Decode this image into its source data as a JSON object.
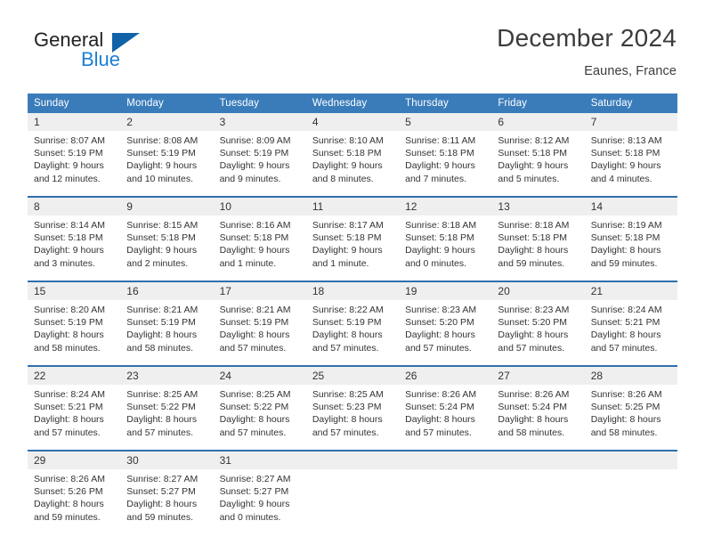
{
  "brand": {
    "name_part1": "General",
    "name_part2": "Blue",
    "triangle_color": "#1163a8",
    "blue_text_color": "#1b7fd4"
  },
  "header": {
    "title": "December 2024",
    "location": "Eaunes, France"
  },
  "theme": {
    "header_blue": "#3a7cba",
    "row_rule_blue": "#2f6fae",
    "daynum_band": "#efefef",
    "text": "#333333"
  },
  "calendar": {
    "weekday_headers": [
      "Sunday",
      "Monday",
      "Tuesday",
      "Wednesday",
      "Thursday",
      "Friday",
      "Saturday"
    ],
    "weeks": [
      {
        "days": [
          {
            "date": "1",
            "sunrise": "Sunrise: 8:07 AM",
            "sunset": "Sunset: 5:19 PM",
            "daylight_line1": "Daylight: 9 hours",
            "daylight_line2": "and 12 minutes."
          },
          {
            "date": "2",
            "sunrise": "Sunrise: 8:08 AM",
            "sunset": "Sunset: 5:19 PM",
            "daylight_line1": "Daylight: 9 hours",
            "daylight_line2": "and 10 minutes."
          },
          {
            "date": "3",
            "sunrise": "Sunrise: 8:09 AM",
            "sunset": "Sunset: 5:19 PM",
            "daylight_line1": "Daylight: 9 hours",
            "daylight_line2": "and 9 minutes."
          },
          {
            "date": "4",
            "sunrise": "Sunrise: 8:10 AM",
            "sunset": "Sunset: 5:18 PM",
            "daylight_line1": "Daylight: 9 hours",
            "daylight_line2": "and 8 minutes."
          },
          {
            "date": "5",
            "sunrise": "Sunrise: 8:11 AM",
            "sunset": "Sunset: 5:18 PM",
            "daylight_line1": "Daylight: 9 hours",
            "daylight_line2": "and 7 minutes."
          },
          {
            "date": "6",
            "sunrise": "Sunrise: 8:12 AM",
            "sunset": "Sunset: 5:18 PM",
            "daylight_line1": "Daylight: 9 hours",
            "daylight_line2": "and 5 minutes."
          },
          {
            "date": "7",
            "sunrise": "Sunrise: 8:13 AM",
            "sunset": "Sunset: 5:18 PM",
            "daylight_line1": "Daylight: 9 hours",
            "daylight_line2": "and 4 minutes."
          }
        ]
      },
      {
        "days": [
          {
            "date": "8",
            "sunrise": "Sunrise: 8:14 AM",
            "sunset": "Sunset: 5:18 PM",
            "daylight_line1": "Daylight: 9 hours",
            "daylight_line2": "and 3 minutes."
          },
          {
            "date": "9",
            "sunrise": "Sunrise: 8:15 AM",
            "sunset": "Sunset: 5:18 PM",
            "daylight_line1": "Daylight: 9 hours",
            "daylight_line2": "and 2 minutes."
          },
          {
            "date": "10",
            "sunrise": "Sunrise: 8:16 AM",
            "sunset": "Sunset: 5:18 PM",
            "daylight_line1": "Daylight: 9 hours",
            "daylight_line2": "and 1 minute."
          },
          {
            "date": "11",
            "sunrise": "Sunrise: 8:17 AM",
            "sunset": "Sunset: 5:18 PM",
            "daylight_line1": "Daylight: 9 hours",
            "daylight_line2": "and 1 minute."
          },
          {
            "date": "12",
            "sunrise": "Sunrise: 8:18 AM",
            "sunset": "Sunset: 5:18 PM",
            "daylight_line1": "Daylight: 9 hours",
            "daylight_line2": "and 0 minutes."
          },
          {
            "date": "13",
            "sunrise": "Sunrise: 8:18 AM",
            "sunset": "Sunset: 5:18 PM",
            "daylight_line1": "Daylight: 8 hours",
            "daylight_line2": "and 59 minutes."
          },
          {
            "date": "14",
            "sunrise": "Sunrise: 8:19 AM",
            "sunset": "Sunset: 5:18 PM",
            "daylight_line1": "Daylight: 8 hours",
            "daylight_line2": "and 59 minutes."
          }
        ]
      },
      {
        "days": [
          {
            "date": "15",
            "sunrise": "Sunrise: 8:20 AM",
            "sunset": "Sunset: 5:19 PM",
            "daylight_line1": "Daylight: 8 hours",
            "daylight_line2": "and 58 minutes."
          },
          {
            "date": "16",
            "sunrise": "Sunrise: 8:21 AM",
            "sunset": "Sunset: 5:19 PM",
            "daylight_line1": "Daylight: 8 hours",
            "daylight_line2": "and 58 minutes."
          },
          {
            "date": "17",
            "sunrise": "Sunrise: 8:21 AM",
            "sunset": "Sunset: 5:19 PM",
            "daylight_line1": "Daylight: 8 hours",
            "daylight_line2": "and 57 minutes."
          },
          {
            "date": "18",
            "sunrise": "Sunrise: 8:22 AM",
            "sunset": "Sunset: 5:19 PM",
            "daylight_line1": "Daylight: 8 hours",
            "daylight_line2": "and 57 minutes."
          },
          {
            "date": "19",
            "sunrise": "Sunrise: 8:23 AM",
            "sunset": "Sunset: 5:20 PM",
            "daylight_line1": "Daylight: 8 hours",
            "daylight_line2": "and 57 minutes."
          },
          {
            "date": "20",
            "sunrise": "Sunrise: 8:23 AM",
            "sunset": "Sunset: 5:20 PM",
            "daylight_line1": "Daylight: 8 hours",
            "daylight_line2": "and 57 minutes."
          },
          {
            "date": "21",
            "sunrise": "Sunrise: 8:24 AM",
            "sunset": "Sunset: 5:21 PM",
            "daylight_line1": "Daylight: 8 hours",
            "daylight_line2": "and 57 minutes."
          }
        ]
      },
      {
        "days": [
          {
            "date": "22",
            "sunrise": "Sunrise: 8:24 AM",
            "sunset": "Sunset: 5:21 PM",
            "daylight_line1": "Daylight: 8 hours",
            "daylight_line2": "and 57 minutes."
          },
          {
            "date": "23",
            "sunrise": "Sunrise: 8:25 AM",
            "sunset": "Sunset: 5:22 PM",
            "daylight_line1": "Daylight: 8 hours",
            "daylight_line2": "and 57 minutes."
          },
          {
            "date": "24",
            "sunrise": "Sunrise: 8:25 AM",
            "sunset": "Sunset: 5:22 PM",
            "daylight_line1": "Daylight: 8 hours",
            "daylight_line2": "and 57 minutes."
          },
          {
            "date": "25",
            "sunrise": "Sunrise: 8:25 AM",
            "sunset": "Sunset: 5:23 PM",
            "daylight_line1": "Daylight: 8 hours",
            "daylight_line2": "and 57 minutes."
          },
          {
            "date": "26",
            "sunrise": "Sunrise: 8:26 AM",
            "sunset": "Sunset: 5:24 PM",
            "daylight_line1": "Daylight: 8 hours",
            "daylight_line2": "and 57 minutes."
          },
          {
            "date": "27",
            "sunrise": "Sunrise: 8:26 AM",
            "sunset": "Sunset: 5:24 PM",
            "daylight_line1": "Daylight: 8 hours",
            "daylight_line2": "and 58 minutes."
          },
          {
            "date": "28",
            "sunrise": "Sunrise: 8:26 AM",
            "sunset": "Sunset: 5:25 PM",
            "daylight_line1": "Daylight: 8 hours",
            "daylight_line2": "and 58 minutes."
          }
        ]
      },
      {
        "days": [
          {
            "date": "29",
            "sunrise": "Sunrise: 8:26 AM",
            "sunset": "Sunset: 5:26 PM",
            "daylight_line1": "Daylight: 8 hours",
            "daylight_line2": "and 59 minutes."
          },
          {
            "date": "30",
            "sunrise": "Sunrise: 8:27 AM",
            "sunset": "Sunset: 5:27 PM",
            "daylight_line1": "Daylight: 8 hours",
            "daylight_line2": "and 59 minutes."
          },
          {
            "date": "31",
            "sunrise": "Sunrise: 8:27 AM",
            "sunset": "Sunset: 5:27 PM",
            "daylight_line1": "Daylight: 9 hours",
            "daylight_line2": "and 0 minutes."
          },
          {
            "date": "",
            "sunrise": "",
            "sunset": "",
            "daylight_line1": "",
            "daylight_line2": ""
          },
          {
            "date": "",
            "sunrise": "",
            "sunset": "",
            "daylight_line1": "",
            "daylight_line2": ""
          },
          {
            "date": "",
            "sunrise": "",
            "sunset": "",
            "daylight_line1": "",
            "daylight_line2": ""
          },
          {
            "date": "",
            "sunrise": "",
            "sunset": "",
            "daylight_line1": "",
            "daylight_line2": ""
          }
        ]
      }
    ]
  }
}
